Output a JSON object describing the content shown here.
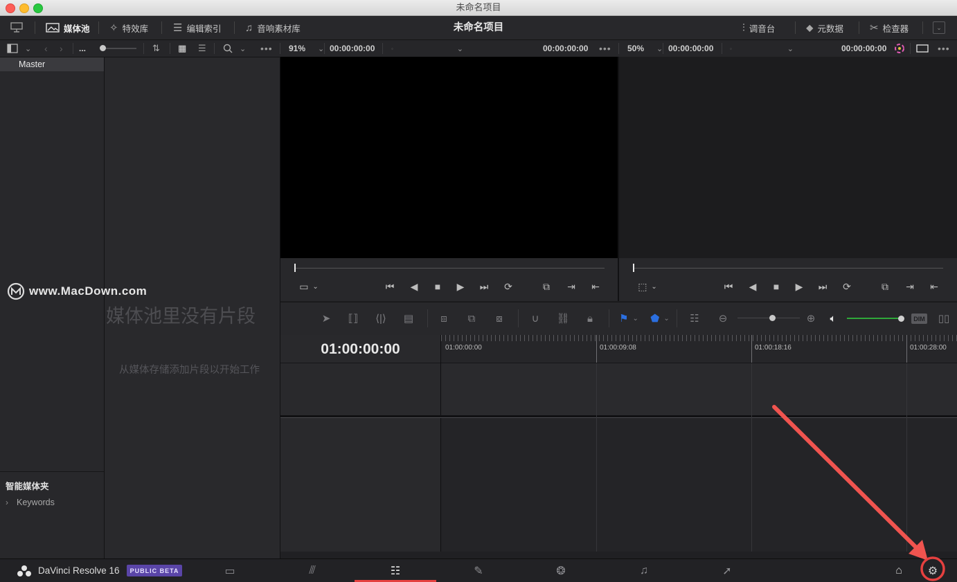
{
  "window": {
    "title": "未命名项目"
  },
  "toolbar": {
    "media_pool": "媒体池",
    "effects": "特效库",
    "edit_index": "编辑索引",
    "sound_library": "音响素材库",
    "project_title": "未命名项目",
    "mixer": "调音台",
    "metadata": "元数据",
    "inspector": "检查器"
  },
  "subbar": {
    "ellipsis": "...",
    "zoom_left": "91%",
    "source_timecode": "00:00:00:00",
    "source_timecode_right": "00:00:00:00",
    "zoom_right": "50%",
    "timeline_timecode": "00:00:00:00",
    "timeline_timecode_right": "00:00:00:00"
  },
  "bins": {
    "master": "Master",
    "smart_bins_title": "智能媒体夹",
    "keywords": "Keywords"
  },
  "media_pool": {
    "watermark": "www.MacDown.com",
    "empty_title": "媒体池里没有片段",
    "empty_hint": "从媒体存储添加片段以开始工作"
  },
  "timeline": {
    "current_timecode": "01:00:00:00",
    "ruler": [
      "01:00:00:00",
      "01:00:09:08",
      "01:00:18:16",
      "01:00:28:00"
    ],
    "dim_label": "DIM"
  },
  "footer": {
    "app_name": "DaVinci Resolve 16",
    "beta_badge": "PUBLIC BETA",
    "pages": [
      "media-icon",
      "cut-icon",
      "edit-icon",
      "fusion-icon",
      "color-icon",
      "fairlight-icon",
      "deliver-icon"
    ],
    "active_page": "edit-icon"
  },
  "colors": {
    "accent_red": "#e5403f",
    "beta_badge_bg": "#5a45a8",
    "audio_meter_green": "#2fa83a",
    "flag_blue": "#2b6fe0",
    "annotation_arrow": "#f0544f"
  }
}
